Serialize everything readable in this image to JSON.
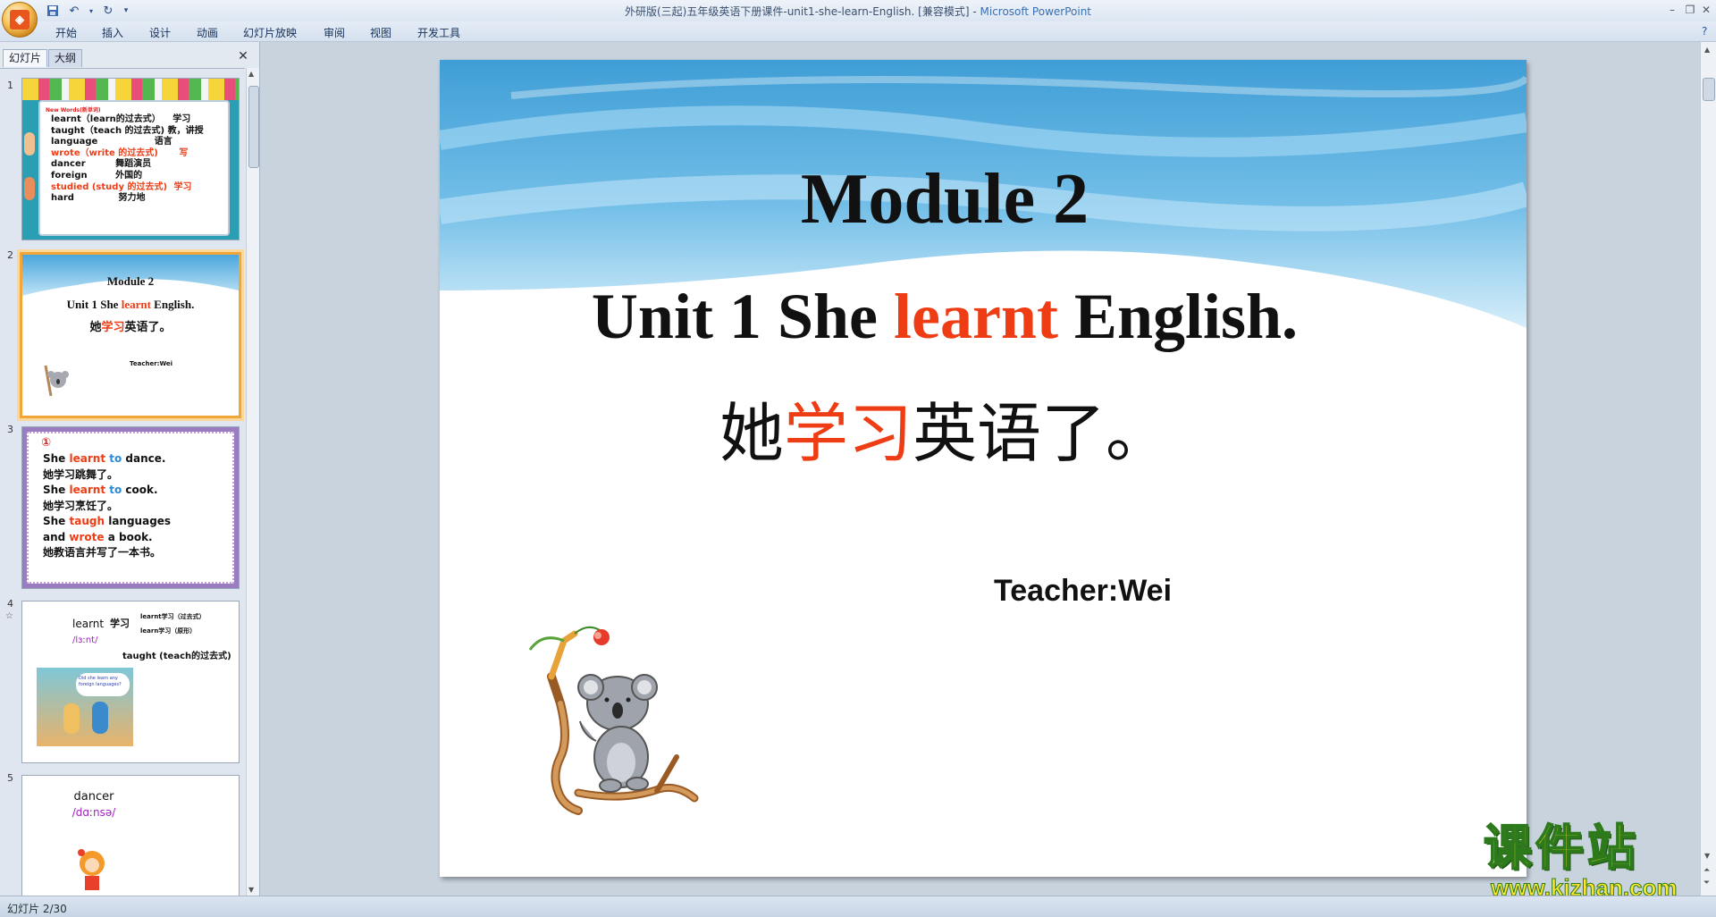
{
  "window": {
    "title": "外研版(三起)五年级英语下册课件-unit1-she-learn-English. [兼容模式] - ",
    "app_name": "Microsoft PowerPoint",
    "qat_icons": [
      "save-icon",
      "undo-icon",
      "redo-icon",
      "customize-icon"
    ]
  },
  "ribbon": {
    "tabs": [
      "开始",
      "插入",
      "设计",
      "动画",
      "幻灯片放映",
      "审阅",
      "视图",
      "开发工具"
    ]
  },
  "left_pane": {
    "tab_slides": "幻灯片",
    "tab_outline": "大纲",
    "close_icon": "close-icon",
    "thumbnails": [
      {
        "number": "1",
        "header": "New Words(新单词)",
        "lines": [
          {
            "en": "learnt（learn的过去式）",
            "cn": "学习",
            "red": false
          },
          {
            "en": "taught（teach 的过去式)",
            "cn": "教，讲授",
            "red": false
          },
          {
            "en": "language",
            "cn": "语言",
            "red": false
          },
          {
            "en": "wrote（write 的过去式)",
            "cn": "写",
            "red": true
          },
          {
            "en": "dancer",
            "cn": "舞蹈演员",
            "red": false
          },
          {
            "en": "foreign",
            "cn": "外国的",
            "red": false
          },
          {
            "en": "studied (study 的过去式)",
            "cn": "学习",
            "red": true
          },
          {
            "en": "hard",
            "cn": "努力地",
            "red": false
          }
        ]
      },
      {
        "number": "2",
        "title": "Module 2",
        "subtitle_a": "Unit 1 She ",
        "subtitle_b": "learnt",
        "subtitle_c": " English.",
        "cn_a": "她",
        "cn_b": "学习",
        "cn_c": "英语了。",
        "teacher": "Teacher:Wei"
      },
      {
        "number": "3",
        "marker": "①",
        "l1a": "She ",
        "l1b": "learnt",
        "l1c": "  to",
        "l1d": " dance.",
        "l2": "她学习跳舞了。",
        "l3a": "She ",
        "l3b": "learnt",
        "l3c": " to",
        "l3d": " cook.",
        "l4": " 她学习烹饪了。",
        "l5a": "She ",
        "l5b": "taugh",
        "l5c": " languages",
        "l6a": "and ",
        "l6b": "wrote",
        "l6c": " a book.",
        "l7": " 她教语言并写了一本书。"
      },
      {
        "number": "4",
        "word": "learnt",
        "cn": "学习",
        "phon": "/lɜːnt/",
        "note1": "learnt学习（过去式）",
        "note2": "learn学习（原形）",
        "note3": "taught (teach的过去式)",
        "bubble": "Did she learn any foreign languages?"
      },
      {
        "number": "5",
        "word": "dancer",
        "phon": "/dɑːnsə/"
      }
    ]
  },
  "slide": {
    "module": "Module 2",
    "unit_a": "Unit 1 She ",
    "unit_b": "learnt",
    "unit_c": " English.",
    "cn_a": "她",
    "cn_b": "学习",
    "cn_c": "英语了。",
    "teacher": "Teacher:Wei"
  },
  "watermark": {
    "cn": "课件站",
    "url": "www.kjzhan.com"
  },
  "status": {
    "slide_indicator": "幻灯片 2/30"
  },
  "colors": {
    "accent_red": "#ee3c14",
    "thumb_selected": "#f2a63a",
    "sky_blue": "#5fb4e2"
  }
}
